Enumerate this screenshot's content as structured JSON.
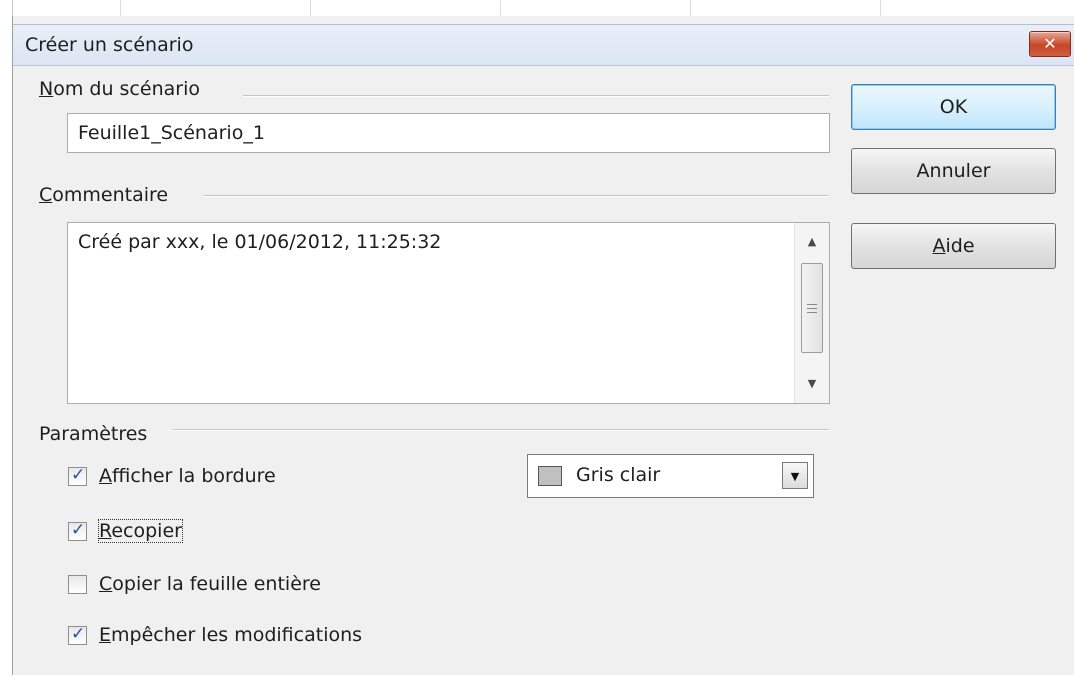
{
  "window": {
    "title": "Créer un scénario",
    "close_label": "✕"
  },
  "scenario_name": {
    "label_accel": "N",
    "label_rest": "om du scénario",
    "value": "Feuille1_Scénario_1"
  },
  "comment": {
    "label_accel": "C",
    "label_rest": "ommentaire",
    "value": "Créé par xxx, le 01/06/2012, 11:25:32"
  },
  "settings": {
    "label": "Paramètres",
    "options": [
      {
        "accel": "A",
        "rest": "fficher la bordure",
        "checked": true
      },
      {
        "accel": "R",
        "rest": "ecopier",
        "checked": true
      },
      {
        "accel": "C",
        "rest": "opier la feuille entière",
        "checked": false
      },
      {
        "accel": "E",
        "rest": "mpêcher les modifications",
        "checked": true
      }
    ],
    "border_color": {
      "value": "Gris clair",
      "swatch": "#c0c0c0"
    }
  },
  "buttons": {
    "ok": "OK",
    "cancel": "Annuler",
    "help_accel": "A",
    "help_rest": "ide"
  }
}
